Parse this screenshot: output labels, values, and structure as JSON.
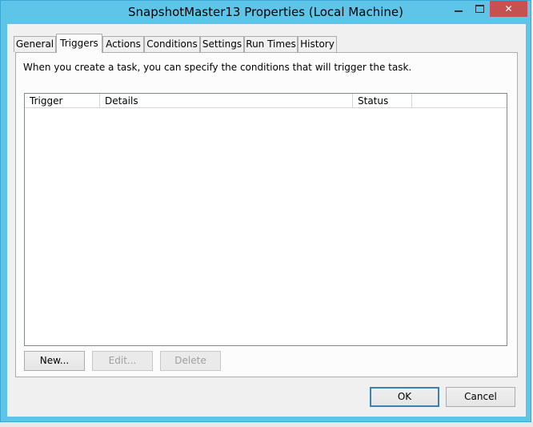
{
  "window": {
    "title": "SnapshotMaster13 Properties (Local Machine)"
  },
  "tabs": [
    {
      "label": "General",
      "active": false
    },
    {
      "label": "Triggers",
      "active": true
    },
    {
      "label": "Actions",
      "active": false
    },
    {
      "label": "Conditions",
      "active": false
    },
    {
      "label": "Settings",
      "active": false
    },
    {
      "label": "Run Times",
      "active": false
    },
    {
      "label": "History",
      "active": false
    }
  ],
  "triggers": {
    "description": "When you create a task, you can specify the conditions that will trigger the task.",
    "columns": [
      "Trigger",
      "Details",
      "Status"
    ],
    "rows": [],
    "buttons": {
      "new": "New...",
      "edit": "Edit...",
      "delete": "Delete"
    }
  },
  "footer": {
    "ok": "OK",
    "cancel": "Cancel"
  },
  "colors": {
    "title_bar": "#5fc5e8",
    "close_button": "#c75050"
  }
}
